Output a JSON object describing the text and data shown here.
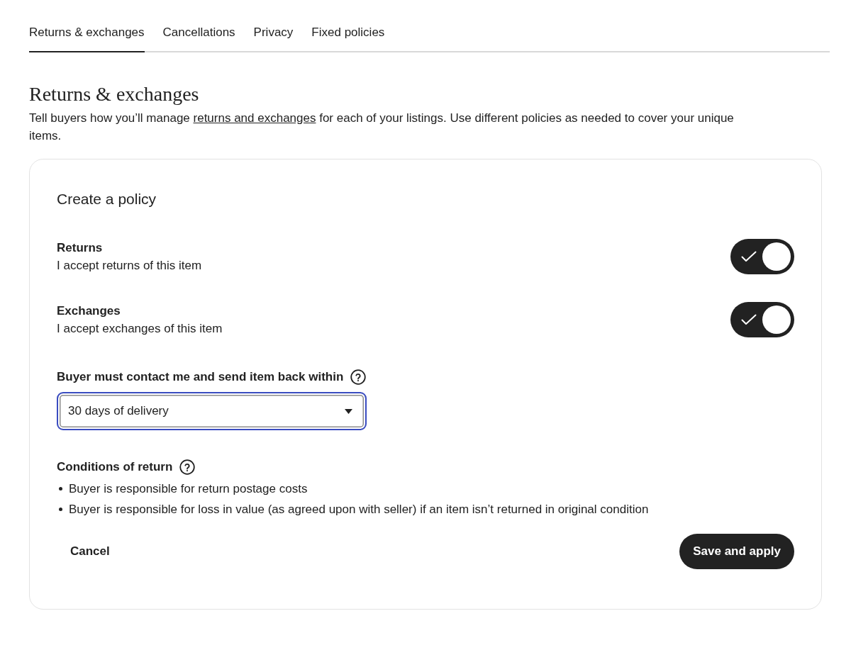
{
  "tabs": [
    {
      "label": "Returns & exchanges",
      "selected": true
    },
    {
      "label": "Cancellations",
      "selected": false
    },
    {
      "label": "Privacy",
      "selected": false
    },
    {
      "label": "Fixed policies",
      "selected": false
    }
  ],
  "heading": "Returns & exchanges",
  "description": {
    "before": "Tell buyers how you’ll manage ",
    "link": "returns and exchanges",
    "after": " for each of your listings. Use different policies as needed to cover your unique items."
  },
  "policy_card": {
    "title": "Create a policy",
    "toggles": [
      {
        "label": "Returns",
        "description": "I accept returns of this item",
        "on": true
      },
      {
        "label": "Exchanges",
        "description": "I accept exchanges of this item",
        "on": true
      }
    ],
    "return_window": {
      "label": "Buyer must contact me and send item back within",
      "value": "30 days of delivery",
      "focused": true
    },
    "conditions": {
      "label": "Conditions of return",
      "items": [
        "Buyer is responsible for return postage costs",
        "Buyer is responsible for loss in value (as agreed upon with seller) if an item isn’t returned in original condition"
      ]
    },
    "buttons": {
      "cancel": "Cancel",
      "save": "Save and apply"
    }
  }
}
